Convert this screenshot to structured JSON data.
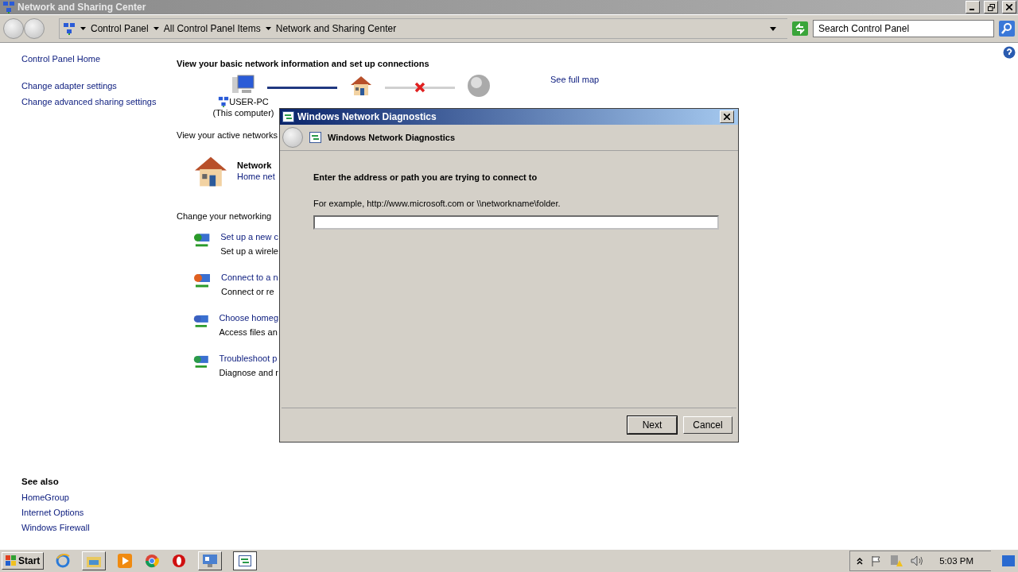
{
  "window": {
    "title": "Network and Sharing Center"
  },
  "address_bar": {
    "breadcrumbs": [
      "Control Panel",
      "All Control Panel Items",
      "Network and Sharing Center"
    ]
  },
  "search": {
    "placeholder": "Search Control Panel"
  },
  "nav": {
    "links": [
      "Control Panel Home",
      "Change adapter settings",
      "Change advanced sharing settings"
    ]
  },
  "see_also": {
    "title": "See also",
    "links": [
      "HomeGroup",
      "Internet Options",
      "Windows Firewall"
    ]
  },
  "main": {
    "heading": "View your basic network information and set up connections",
    "map": {
      "computer": {
        "name": "USER-PC",
        "note": "(This computer)"
      },
      "links": [
        {
          "connected": true
        },
        {
          "connected": false
        }
      ],
      "full_map": "See full map"
    },
    "active_heading": "View your active networks",
    "network": {
      "name": "Network",
      "type": "Home net"
    },
    "change_heading": "Change your networking",
    "tasks": [
      {
        "kind": "new",
        "title": "Set up a new c",
        "description": "Set up a wirele"
      },
      {
        "kind": "connect",
        "title": "Connect to a n",
        "description": "Connect or re"
      },
      {
        "kind": "homegroup",
        "title": "Choose homeg",
        "description": "Access files an"
      },
      {
        "kind": "troubleshoot",
        "title": "Troubleshoot p",
        "description": "Diagnose and r"
      }
    ]
  },
  "dialog": {
    "title": "Windows Network Diagnostics",
    "header": "Windows Network Diagnostics",
    "prompt": "Enter the address or path you are trying to connect to",
    "example": "For example, http://www.microsoft.com or \\\\networkname\\folder.",
    "buttons": [
      "Next",
      "Cancel"
    ]
  },
  "taskbar": {
    "start": "Start",
    "clock": "5:03 PM"
  }
}
